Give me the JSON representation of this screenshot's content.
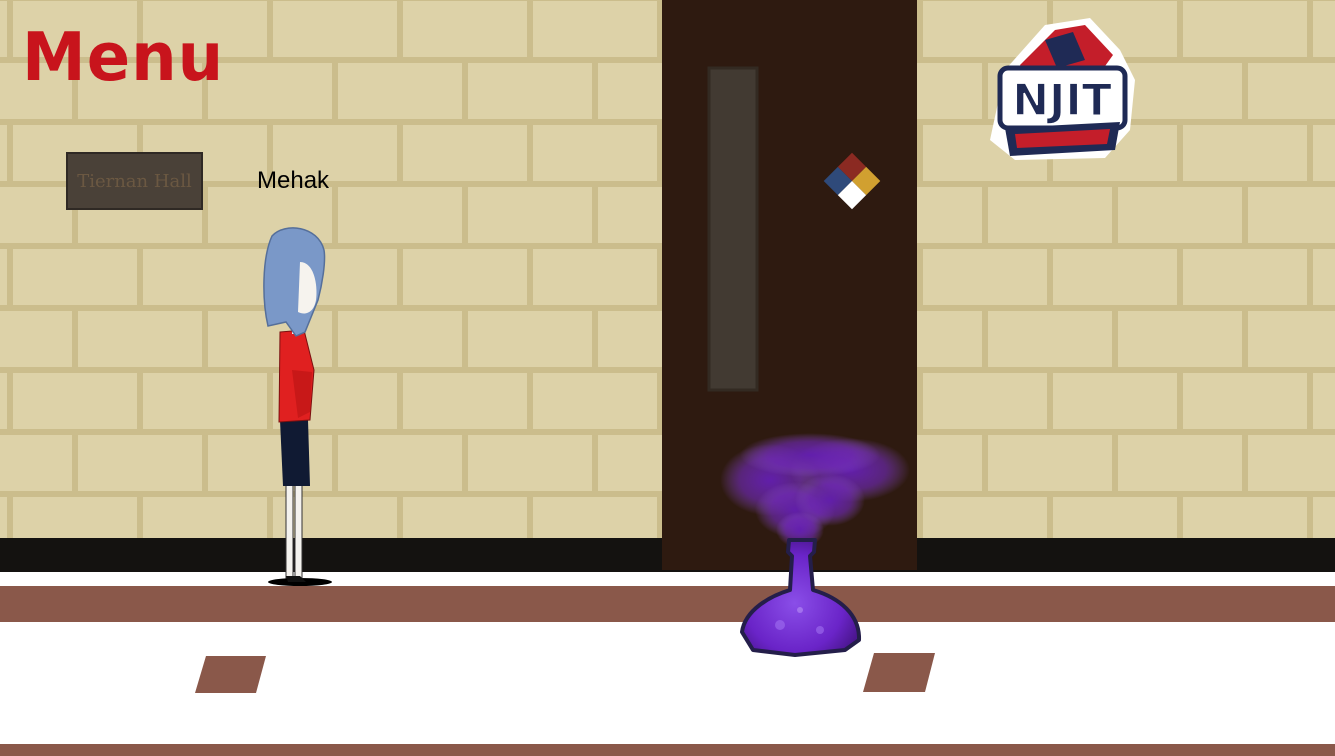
{
  "hud": {
    "menu_label": "Menu",
    "logo_text": "NJIT"
  },
  "scene": {
    "room_sign_text": "Tiernan Hall",
    "player_name": "Mehak"
  },
  "colors": {
    "wall": "#ddd2a8",
    "mortar": "#cbbd8c",
    "door": "#2e1a10",
    "floor_band": "#8a584a",
    "floor": "#ffffff",
    "menu_red": "#c8141c",
    "potion": "#7a2fd0"
  }
}
